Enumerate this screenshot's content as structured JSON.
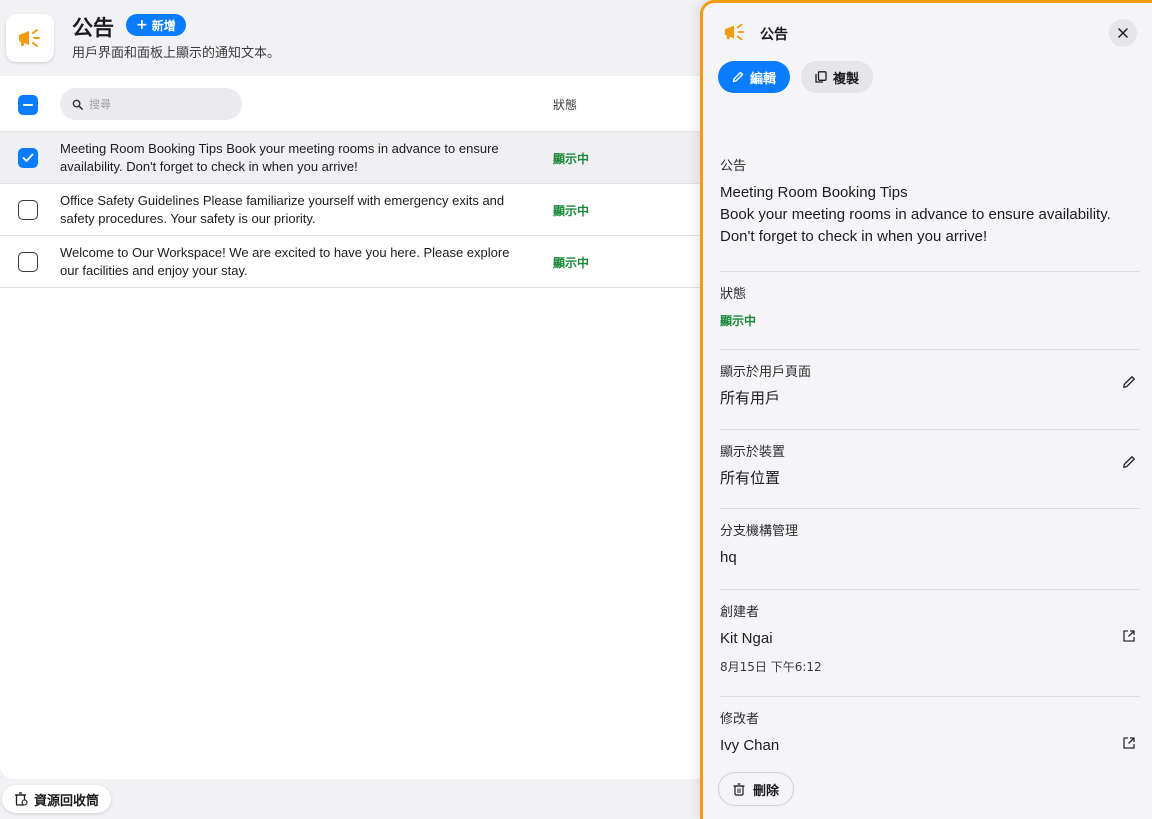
{
  "header": {
    "title": "公告",
    "add_label": "新增",
    "subtitle": "用戶界面和面板上顯示的通知文本。"
  },
  "list": {
    "search_placeholder": "搜尋",
    "status_column": "狀態",
    "rows": [
      {
        "text": "Meeting Room Booking Tips Book your meeting rooms in advance to ensure availability. Don't forget to check in when you arrive!",
        "status": "顯示中",
        "checked": true
      },
      {
        "text": "Office Safety Guidelines Please familiarize yourself with emergency exits and safety procedures. Your safety is our priority.",
        "status": "顯示中",
        "checked": false
      },
      {
        "text": "Welcome to Our Workspace! We are excited to have you here. Please explore our facilities and enjoy your stay.",
        "status": "顯示中",
        "checked": false
      }
    ]
  },
  "recycle_bin_label": "資源回收筒",
  "panel": {
    "title": "公告",
    "edit_label": "編輯",
    "copy_label": "複製",
    "announcement": {
      "label": "公告",
      "line1": "Meeting Room Booking Tips",
      "line2": "Book your meeting rooms in advance to ensure availability.",
      "line3": "Don't forget to check in when you arrive!"
    },
    "status": {
      "label": "狀態",
      "value": "顯示中"
    },
    "user_pages": {
      "label": "顯示於用戶頁面",
      "value": "所有用戶"
    },
    "devices": {
      "label": "顯示於裝置",
      "value": "所有位置"
    },
    "branch": {
      "label": "分支機構管理",
      "value": "hq"
    },
    "creator": {
      "label": "創建者",
      "value": "Kit Ngai",
      "time": "8月15日 下午6:12"
    },
    "modifier": {
      "label": "修改者",
      "value": "Ivy Chan"
    },
    "delete_label": "刪除"
  },
  "colors": {
    "accent": "#0a7cff",
    "panel_border": "#f39c12",
    "status_green": "#1a8a3a",
    "megaphone": "#f39c12"
  },
  "icons": [
    "megaphone-icon",
    "plus-icon",
    "search-icon",
    "check-icon",
    "recycle-bin-icon",
    "close-icon",
    "pencil-icon",
    "copy-icon",
    "external-link-icon",
    "trash-icon"
  ]
}
